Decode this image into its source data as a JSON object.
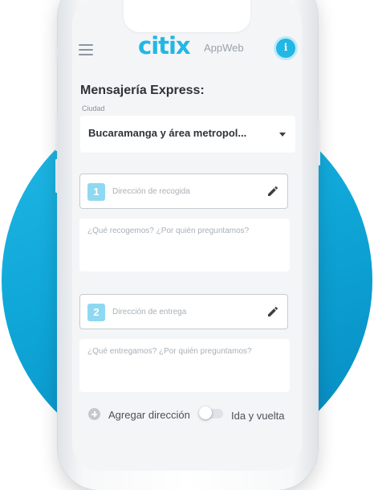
{
  "brand": {
    "logo": "citix",
    "subtitle": "AppWeb"
  },
  "colors": {
    "accent": "#22b7e4",
    "background_circle": "#0fa7d8"
  },
  "header": {
    "menu_icon": "hamburger-icon",
    "info_icon": "info-icon"
  },
  "form": {
    "title": "Mensajería Express:",
    "city_label": "Ciudad",
    "city_value": "Bucaramanga y área metropol...",
    "stops": [
      {
        "number": "1",
        "placeholder": "Dirección de recogida",
        "note_placeholder": "¿Qué recogemos? ¿Por quién preguntamos?"
      },
      {
        "number": "2",
        "placeholder": "Dirección de entrega",
        "note_placeholder": "¿Qué entregamos? ¿Por quién preguntamos?"
      }
    ],
    "add_address": "Agregar dirección",
    "round_trip": "Ida y vuelta",
    "round_trip_on": false
  }
}
